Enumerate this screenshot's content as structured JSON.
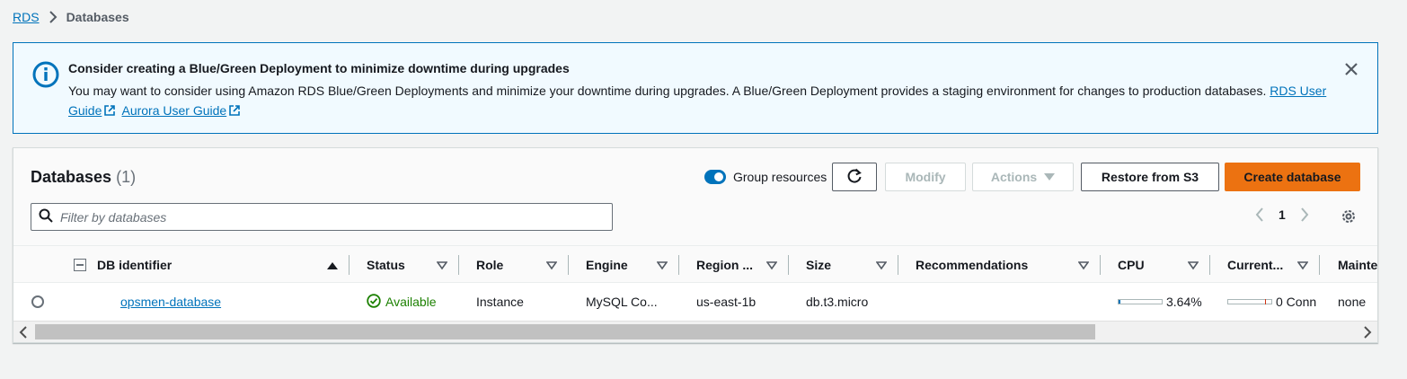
{
  "breadcrumb": {
    "root": "RDS",
    "current": "Databases"
  },
  "flash": {
    "title": "Consider creating a Blue/Green Deployment to minimize downtime during upgrades",
    "body": "You may want to consider using Amazon RDS Blue/Green Deployments and minimize your downtime during upgrades. A Blue/Green Deployment provides a staging environment for changes to production databases.",
    "link1": "RDS User Guide",
    "link2": "Aurora User Guide",
    "info_icon": "info-icon",
    "close_icon": "close-icon"
  },
  "panel": {
    "title": "Databases",
    "count": "(1)",
    "group_resources_label": "Group resources",
    "group_resources_on": true,
    "buttons": {
      "refresh_icon": "refresh-icon",
      "modify": "Modify",
      "actions": "Actions",
      "restore": "Restore from S3",
      "create": "Create database"
    },
    "search": {
      "placeholder": "Filter by databases",
      "value": ""
    },
    "pagination": {
      "current_page": "1"
    }
  },
  "table": {
    "columns": [
      "DB identifier",
      "Status",
      "Role",
      "Engine",
      "Region ...",
      "Size",
      "Recommendations",
      "CPU",
      "Current...",
      "Mainte"
    ],
    "rows": [
      {
        "db_identifier": "opsmen-database",
        "status": "Available",
        "role": "Instance",
        "engine": "MySQL Co...",
        "region": "us-east-1b",
        "size": "db.t3.micro",
        "recommendations": "",
        "cpu": "3.64%",
        "cpu_fraction": 0.0364,
        "current_activity": "0 Conn",
        "maintenance": "none"
      }
    ]
  },
  "colors": {
    "link": "#0073bb",
    "primary_button": "#ec7211",
    "success": "#1d8102",
    "flash_bg": "#f1faff",
    "flash_border": "#0073bb"
  }
}
